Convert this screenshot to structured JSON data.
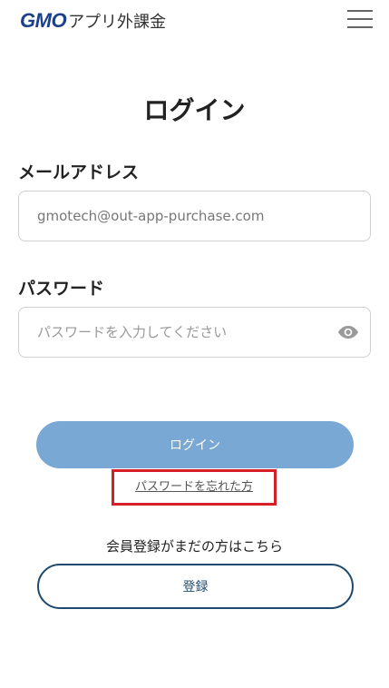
{
  "header": {
    "logo_mark": "GMO",
    "logo_text": "アプリ外課金",
    "menu_icon": "hamburger-icon"
  },
  "page": {
    "title": "ログイン"
  },
  "email": {
    "label": "メールアドレス",
    "value": "gmotech@out-app-purchase.com"
  },
  "password": {
    "label": "パスワード",
    "placeholder": "パスワードを入力してください",
    "toggle_icon": "eye-icon"
  },
  "actions": {
    "login_label": "ログイン",
    "forgot_label": "パスワードを忘れた方",
    "register_prompt": "会員登録がまだの方はこちら",
    "register_label": "登録"
  },
  "colors": {
    "brand": "#1d3f8f",
    "login_button": "#7aa8d4",
    "register_border": "#1f4a6e",
    "highlight": "#d61f26"
  }
}
